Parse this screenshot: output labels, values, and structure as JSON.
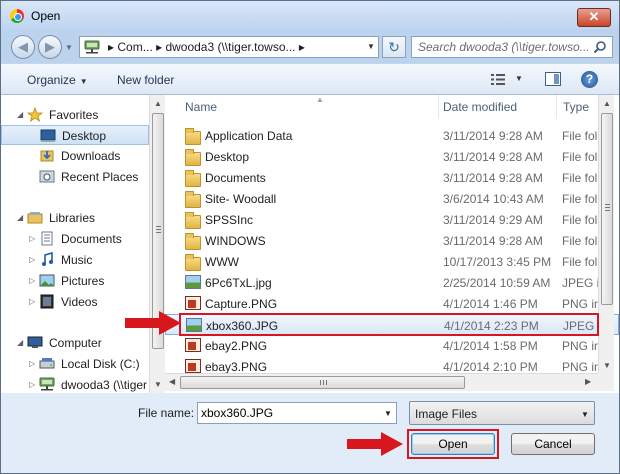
{
  "window": {
    "title": "Open",
    "close_label": "✕"
  },
  "nav": {
    "back_label": "◀",
    "forward_label": "▶",
    "address": {
      "crumb1": "Com...",
      "crumb2": "dwooda3 (\\\\tiger.towso...",
      "sep": "▸"
    },
    "refresh_label": "↻",
    "search_placeholder": "Search dwooda3 (\\\\tiger.towso..."
  },
  "toolbar": {
    "organize": "Organize",
    "new_folder": "New folder"
  },
  "sidebar": {
    "items": [
      {
        "label": "Favorites",
        "icon": "star-icon",
        "level": 0,
        "tri": "◢"
      },
      {
        "label": "Desktop",
        "icon": "desktop-icon",
        "level": 1,
        "selected": true
      },
      {
        "label": "Downloads",
        "icon": "downloads-icon",
        "level": 1
      },
      {
        "label": "Recent Places",
        "icon": "recent-places-icon",
        "level": 1
      },
      {
        "label": "Libraries",
        "icon": "libraries-icon",
        "level": 0,
        "tri": "◢"
      },
      {
        "label": "Documents",
        "icon": "documents-icon",
        "level": 1,
        "tri": "▷"
      },
      {
        "label": "Music",
        "icon": "music-icon",
        "level": 1,
        "tri": "▷"
      },
      {
        "label": "Pictures",
        "icon": "pictures-icon",
        "level": 1,
        "tri": "▷"
      },
      {
        "label": "Videos",
        "icon": "videos-icon",
        "level": 1,
        "tri": "▷"
      },
      {
        "label": "Computer",
        "icon": "computer-icon",
        "level": 0,
        "tri": "◢"
      },
      {
        "label": "Local Disk (C:)",
        "icon": "local-disk-icon",
        "level": 1,
        "tri": "▷"
      },
      {
        "label": "dwooda3 (\\\\tiger",
        "icon": "network-drive-icon",
        "level": 1,
        "tri": "▷"
      }
    ]
  },
  "columns": {
    "name": "Name",
    "date": "Date modified",
    "type": "Type"
  },
  "files": [
    {
      "name": "Application Data",
      "date": "3/11/2014 9:28 AM",
      "type": "File fol",
      "kind": "folder"
    },
    {
      "name": "Desktop",
      "date": "3/11/2014 9:28 AM",
      "type": "File fol",
      "kind": "folder"
    },
    {
      "name": "Documents",
      "date": "3/11/2014 9:28 AM",
      "type": "File fol",
      "kind": "folder"
    },
    {
      "name": "Site- Woodall",
      "date": "3/6/2014 10:43 AM",
      "type": "File fol",
      "kind": "folder"
    },
    {
      "name": "SPSSInc",
      "date": "3/11/2014 9:29 AM",
      "type": "File fol",
      "kind": "folder"
    },
    {
      "name": "WINDOWS",
      "date": "3/11/2014 9:28 AM",
      "type": "File fol",
      "kind": "folder"
    },
    {
      "name": "WWW",
      "date": "10/17/2013 3:45 PM",
      "type": "File fol",
      "kind": "folder"
    },
    {
      "name": "6Pc6TxL.jpg",
      "date": "2/25/2014 10:59 AM",
      "type": "JPEG in",
      "kind": "jpg"
    },
    {
      "name": "Capture.PNG",
      "date": "4/1/2014 1:46 PM",
      "type": "PNG in",
      "kind": "png"
    },
    {
      "name": "xbox360.JPG",
      "date": "4/1/2014 2:23 PM",
      "type": "JPEG in",
      "kind": "jpg",
      "selected": true
    },
    {
      "name": "ebay2.PNG",
      "date": "4/1/2014 1:58 PM",
      "type": "PNG in",
      "kind": "png"
    },
    {
      "name": "ebay3.PNG",
      "date": "4/1/2014 2:10 PM",
      "type": "PNG in",
      "kind": "png"
    }
  ],
  "bottom": {
    "file_name_label": "File name:",
    "file_name_value": "xbox360.JPG",
    "file_type": "Image Files",
    "open": "Open",
    "cancel": "Cancel"
  },
  "colors": {
    "annotation_red": "#d7161d",
    "selection_border": "#84acdd"
  }
}
